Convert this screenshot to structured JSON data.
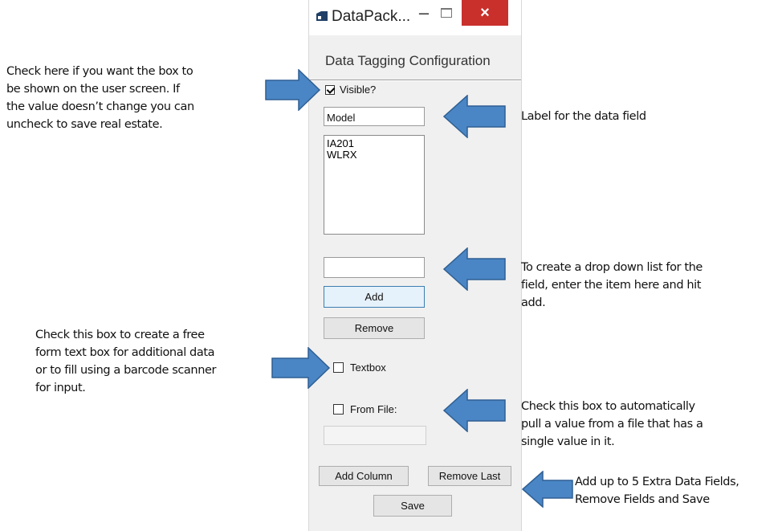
{
  "window": {
    "title": "DataPack...",
    "heading": "Data Tagging Configuration",
    "visible_label": "Visible?",
    "visible_checked": true,
    "field_label_value": "Model",
    "list_items": [
      "IA201",
      "WLRX"
    ],
    "new_item_value": "",
    "add_label": "Add",
    "remove_label": "Remove",
    "textbox_label": "Textbox",
    "textbox_checked": false,
    "from_file_label": "From File:",
    "from_file_checked": false,
    "add_column_label": "Add Column",
    "remove_last_label": "Remove Last",
    "save_label": "Save"
  },
  "annotations": {
    "visible_note": [
      "Check here if you want the box to",
      "be shown on the user screen.  If",
      "the value doesn’t change you can",
      "uncheck to save real estate."
    ],
    "label_note": [
      "Label for the data field"
    ],
    "dropdown_note": [
      "To create a drop down list for the",
      "field, enter the item here and hit",
      "add."
    ],
    "textbox_note": [
      "Check this box to create a free",
      "form text box for additional data",
      "or to fill using a barcode scanner",
      "for input."
    ],
    "file_note": [
      "Check this box to automatically",
      "pull a value from a file that has a",
      "single value in it."
    ],
    "buttons_note": [
      "Add up to 5 Extra Data Fields,",
      "Remove Fields and Save"
    ]
  },
  "colors": {
    "arrow_fill": "#4a86c5",
    "arrow_stroke": "#2f5f93",
    "close_button": "#c9302c"
  },
  "icons": [
    "app-icon",
    "minimize-icon",
    "maximize-icon",
    "close-icon",
    "checkmark-icon",
    "arrow-right-icon",
    "arrow-left-icon"
  ]
}
